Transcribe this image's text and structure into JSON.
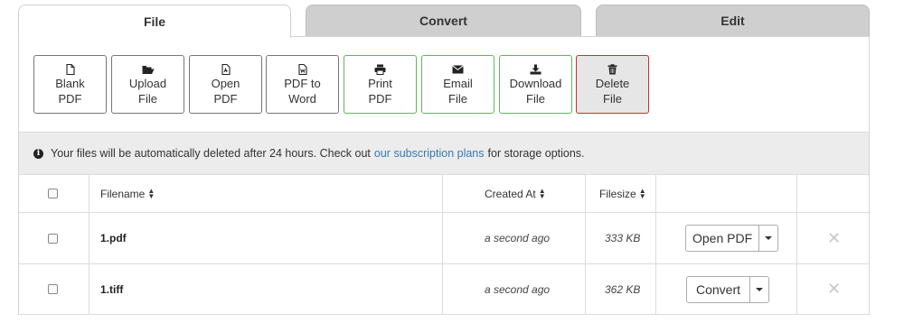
{
  "tabs": [
    {
      "label": "File"
    },
    {
      "label": "Convert"
    },
    {
      "label": "Edit"
    }
  ],
  "toolbar": [
    {
      "line1": "Blank",
      "line2": "PDF",
      "icon": "blank-file-icon"
    },
    {
      "line1": "Upload",
      "line2": "File",
      "icon": "folder-open-icon"
    },
    {
      "line1": "Open",
      "line2": "PDF",
      "icon": "pdf-file-icon"
    },
    {
      "line1": "PDF to",
      "line2": "Word",
      "icon": "word-file-icon"
    },
    {
      "line1": "Print",
      "line2": "PDF",
      "icon": "print-icon"
    },
    {
      "line1": "Email",
      "line2": "File",
      "icon": "envelope-icon"
    },
    {
      "line1": "Download",
      "line2": "File",
      "icon": "download-icon"
    },
    {
      "line1": "Delete",
      "line2": "File",
      "icon": "trash-icon"
    }
  ],
  "notice": {
    "before": "Your files will be automatically deleted after 24 hours. Check out",
    "link": "our subscription plans",
    "after": "for storage options."
  },
  "table": {
    "headers": {
      "filename": "Filename",
      "created": "Created At",
      "filesize": "Filesize"
    },
    "rows": [
      {
        "filename": "1.pdf",
        "created": "a second ago",
        "size": "333 KB",
        "action": "Open PDF"
      },
      {
        "filename": "1.tiff",
        "created": "a second ago",
        "size": "362 KB",
        "action": "Convert"
      }
    ]
  },
  "colors": {
    "link": "#337ab7",
    "green_border": "#5cb85c",
    "red_border": "#c9302c"
  }
}
